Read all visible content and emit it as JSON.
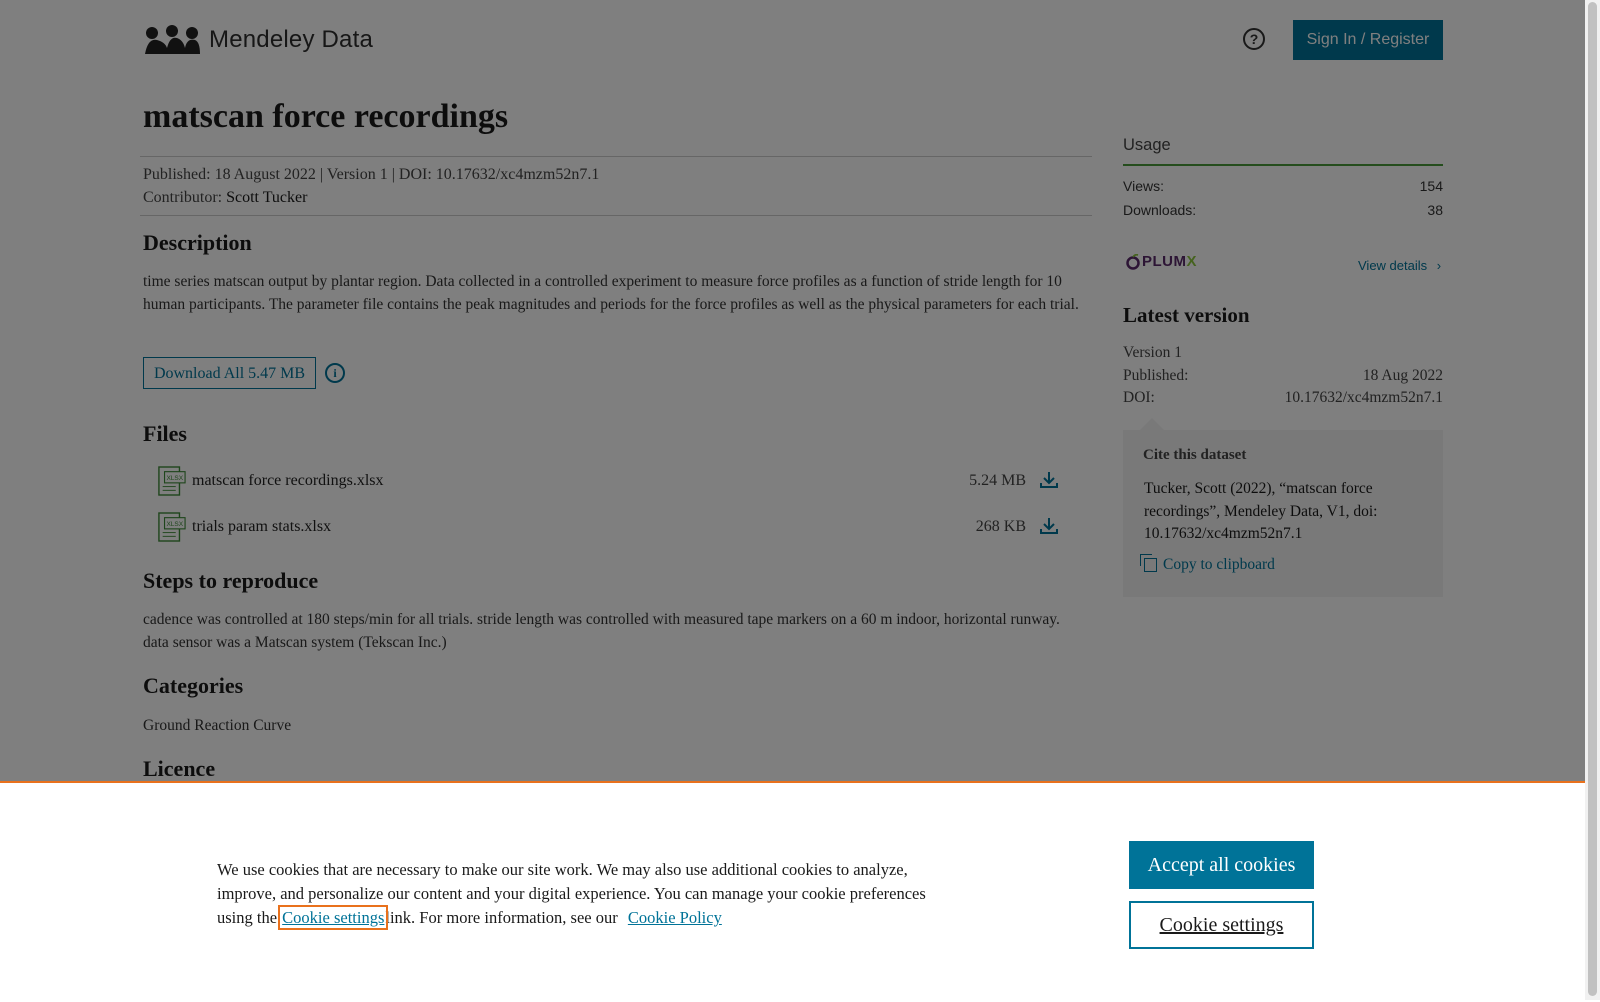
{
  "header": {
    "logo_text": "Mendeley Data",
    "help_icon": "question-circle-icon",
    "signin_label": "Sign In / Register"
  },
  "dataset": {
    "title": "matscan force recordings",
    "published_line": "Published: 18 August 2022 | Version 1 | DOI: 10.17632/xc4mzm52n7.1",
    "contributor_label": "Contributor:",
    "contributor_name": "Scott Tucker"
  },
  "description": {
    "heading": "Description",
    "text": "time series matscan output by plantar region. Data collected in a controlled experiment to measure force profiles as a function of stride length for 10 human participants. The parameter file contains the peak magnitudes and periods for the force profiles as well as the physical parameters for each trial.",
    "download_all_label": "Download All 5.47 MB"
  },
  "files": {
    "heading": "Files",
    "items": [
      {
        "name": "matscan force recordings.xlsx",
        "size": "5.24 MB",
        "icon_label": "XLSX"
      },
      {
        "name": "trials param stats.xlsx",
        "size": "268 KB",
        "icon_label": "XLSX"
      }
    ]
  },
  "steps": {
    "heading": "Steps to reproduce",
    "text": "cadence was controlled at 180 steps/min for all trials. stride length was controlled with measured tape markers on a 60 m indoor, horizontal runway. data sensor was a Matscan system (Tekscan Inc.)"
  },
  "categories": {
    "heading": "Categories",
    "items": [
      "Ground Reaction Curve"
    ]
  },
  "licence": {
    "heading": "Licence"
  },
  "usage": {
    "title": "Usage",
    "views_label": "Views:",
    "views_value": "154",
    "downloads_label": "Downloads:",
    "downloads_value": "38",
    "plumx_main": "PLUM",
    "plumx_x": "X",
    "view_details_label": "View details"
  },
  "latest_version": {
    "heading": "Latest version",
    "version": "Version 1",
    "published_label": "Published:",
    "published_value": "18 Aug 2022",
    "doi_label": "DOI:",
    "doi_value": "10.17632/xc4mzm52n7.1"
  },
  "cite": {
    "title": "Cite this dataset",
    "text": "Tucker, Scott (2022), “matscan force recordings”, Mendeley Data, V1, doi: 10.17632/xc4mzm52n7.1",
    "copy_label": "Copy to clipboard"
  },
  "cookie_banner": {
    "text_1": "We use cookies that are necessary to make our site work. We may also use additional cookies to analyze, improve, and personalize our content and your digital experience. You can manage your cookie preferences using the",
    "settings_link": "Cookie settings",
    "text_2": "link. For more information, see our",
    "policy_link": "Cookie Policy",
    "accept_label": "Accept all cookies",
    "settings_label": "Cookie settings"
  },
  "colors": {
    "brand": "#007398",
    "cookie_accent": "#e9711c",
    "usage_line": "#4a9b3a"
  }
}
